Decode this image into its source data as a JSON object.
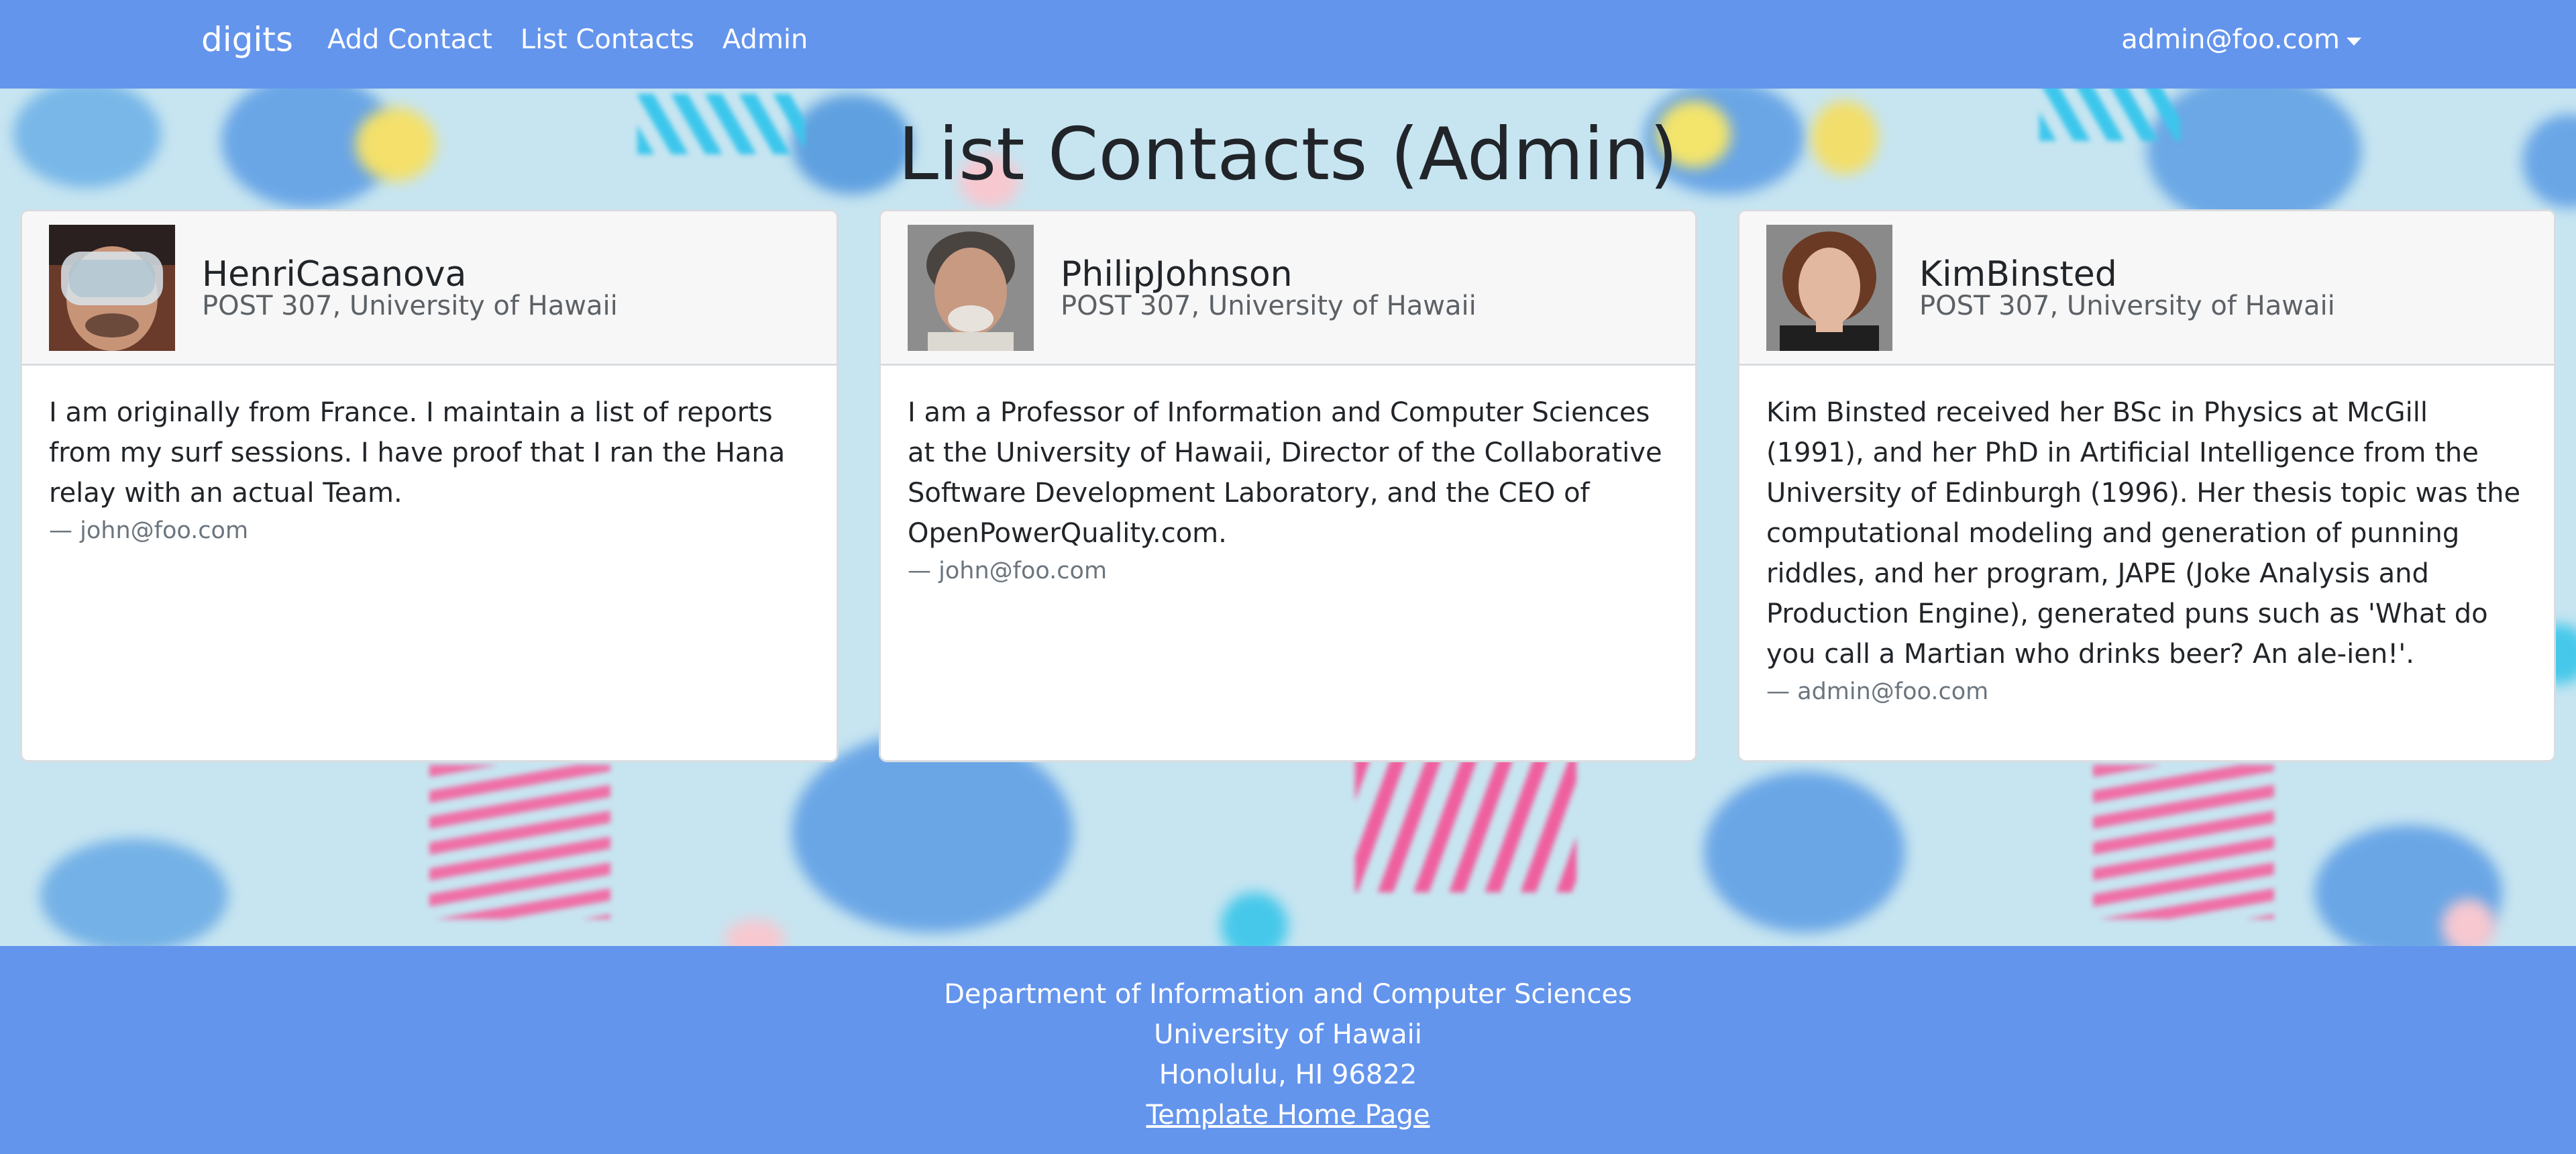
{
  "navbar": {
    "brand": "digits",
    "links": [
      "Add Contact",
      "List Contacts",
      "Admin"
    ],
    "user": "admin@foo.com"
  },
  "page_title": "List Contacts (Admin)",
  "contacts": [
    {
      "name": "HenriCasanova",
      "address": "POST 307, University of Hawaii",
      "description": "I am originally from France. I maintain a list of reports from my surf sessions. I have proof that I ran the Hana relay with an actual Team.",
      "owner": "— john@foo.com"
    },
    {
      "name": "PhilipJohnson",
      "address": "POST 307, University of Hawaii",
      "description": "I am a Professor of Information and Computer Sciences at the University of Hawaii, Director of the Collaborative Software Development Laboratory, and the CEO of OpenPowerQuality.com.",
      "owner": "— john@foo.com"
    },
    {
      "name": "KimBinsted",
      "address": "POST 307, University of Hawaii",
      "description": "Kim Binsted received her BSc in Physics at McGill (1991), and her PhD in Artificial Intelligence from the University of Edinburgh (1996). Her thesis topic was the computational modeling and generation of punning riddles, and her program, JAPE (Joke Analysis and Production Engine), generated puns such as 'What do you call a Martian who drinks beer? An ale-ien!'.",
      "owner": "— admin@foo.com"
    }
  ],
  "footer": {
    "lines": [
      "Department of Information and Computer Sciences",
      "University of Hawaii",
      "Honolulu, HI 96822"
    ],
    "link": "Template Home Page"
  },
  "colors": {
    "navbar": "#6495ed",
    "background": "#c7e5f1"
  }
}
